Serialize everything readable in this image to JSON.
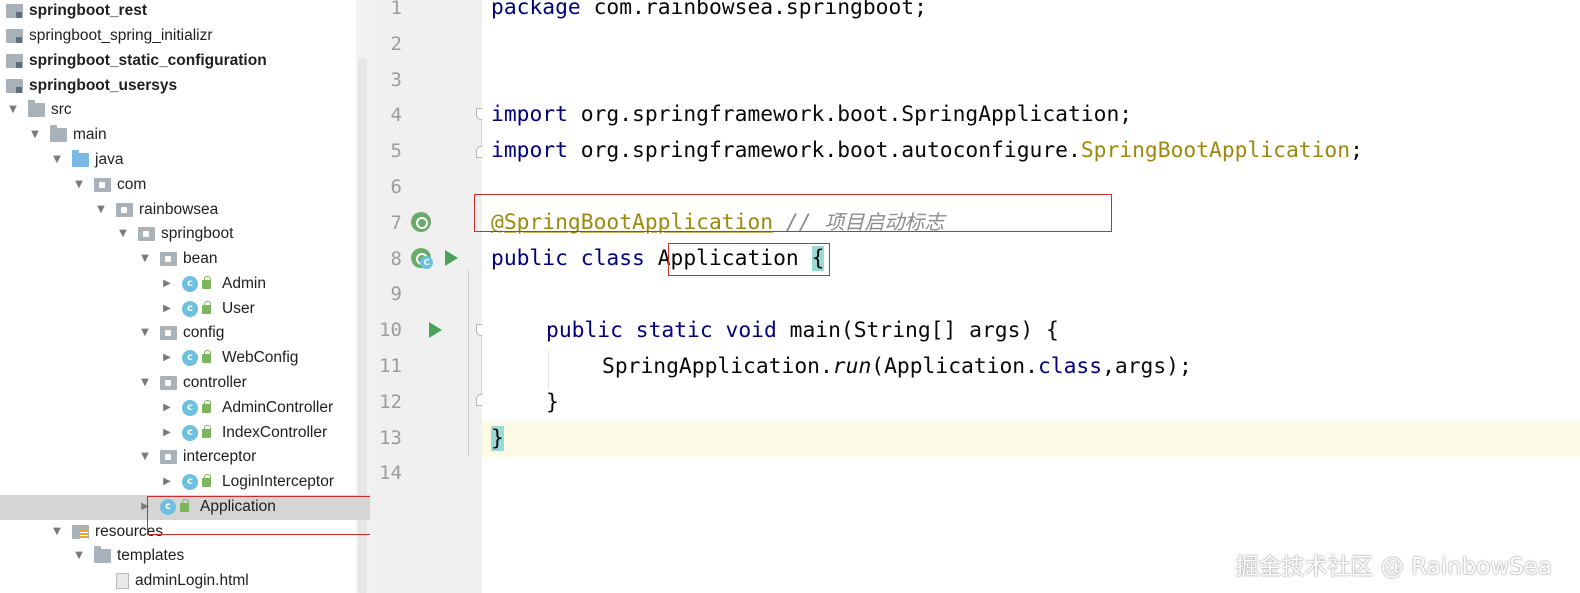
{
  "project_tree": {
    "items": [
      {
        "label": "springboot_rest",
        "icon": "module-icon",
        "bold": true,
        "arrow": "none"
      },
      {
        "label": "springboot_spring_initializr",
        "icon": "module-icon",
        "bold": false,
        "arrow": "none"
      },
      {
        "label": "springboot_static_configuration",
        "icon": "module-icon",
        "bold": true,
        "arrow": "none"
      },
      {
        "label": "springboot_usersys",
        "icon": "module-icon",
        "bold": true,
        "arrow": "none"
      },
      {
        "label": "src",
        "icon": "folder-icon",
        "bold": false,
        "arrow": "expanded"
      },
      {
        "label": "main",
        "icon": "folder-icon",
        "bold": false,
        "arrow": "expanded"
      },
      {
        "label": "java",
        "icon": "source-folder-icon",
        "bold": false,
        "arrow": "expanded"
      },
      {
        "label": "com",
        "icon": "package-icon",
        "bold": false,
        "arrow": "expanded"
      },
      {
        "label": "rainbowsea",
        "icon": "package-icon",
        "bold": false,
        "arrow": "expanded"
      },
      {
        "label": "springboot",
        "icon": "package-icon",
        "bold": false,
        "arrow": "expanded"
      },
      {
        "label": "bean",
        "icon": "package-icon",
        "bold": false,
        "arrow": "expanded"
      },
      {
        "label": "Admin",
        "icon": "class-icon",
        "bold": false,
        "arrow": "collapsed"
      },
      {
        "label": "User",
        "icon": "class-icon",
        "bold": false,
        "arrow": "collapsed"
      },
      {
        "label": "config",
        "icon": "package-icon",
        "bold": false,
        "arrow": "expanded"
      },
      {
        "label": "WebConfig",
        "icon": "class-icon",
        "bold": false,
        "arrow": "collapsed"
      },
      {
        "label": "controller",
        "icon": "package-icon",
        "bold": false,
        "arrow": "expanded"
      },
      {
        "label": "AdminController",
        "icon": "class-icon",
        "bold": false,
        "arrow": "collapsed"
      },
      {
        "label": "IndexController",
        "icon": "class-icon",
        "bold": false,
        "arrow": "collapsed"
      },
      {
        "label": "interceptor",
        "icon": "package-icon",
        "bold": false,
        "arrow": "expanded"
      },
      {
        "label": "LoginInterceptor",
        "icon": "class-icon",
        "bold": false,
        "arrow": "collapsed"
      },
      {
        "label": "Application",
        "icon": "spring-boot-class-icon",
        "bold": false,
        "arrow": "collapsed",
        "selected": true
      },
      {
        "label": "resources",
        "icon": "resources-folder-icon",
        "bold": false,
        "arrow": "expanded"
      },
      {
        "label": "templates",
        "icon": "folder-icon",
        "bold": false,
        "arrow": "expanded"
      },
      {
        "label": "adminLogin.html",
        "icon": "html-file-icon",
        "bold": false,
        "arrow": "none"
      }
    ]
  },
  "editor": {
    "line_numbers": [
      "1",
      "2",
      "3",
      "4",
      "5",
      "6",
      "7",
      "8",
      "9",
      "10",
      "11",
      "12",
      "13",
      "14"
    ],
    "code": {
      "l1_kw": "package",
      "l1_rest": " com.rainbowsea.springboot;",
      "l4_kw": "import",
      "l4_rest": " org.springframework.boot.SpringApplication;",
      "l5_kw": "import",
      "l5_pre": " org.springframework.boot.autoconfigure.",
      "l5_ann": "SpringBootApplication",
      "l5_post": ";",
      "l7_ann": "@SpringBootApplication",
      "l7_cmt": " // ",
      "l7_cmt_cn": "项目启动标志",
      "l8_kw": "public class",
      "l8_name": "Application",
      "l8_brace": "{",
      "l10_kw": "public static void",
      "l10_rest": " main(String[] args) {",
      "l11_pre": "SpringApplication.",
      "l11_method": "run",
      "l11_mid": "(Application.",
      "l11_kw": "class",
      "l11_post": ",args);",
      "l12": "}",
      "l13": "}"
    }
  },
  "watermark": "掘金技术社区 @ RainbowSea",
  "colors": {
    "keyword": "#000080",
    "annotation": "#9e880d",
    "highlight_box": "#d02b2b",
    "run_icon": "#4aa25a",
    "current_line": "#fdfbe6"
  }
}
